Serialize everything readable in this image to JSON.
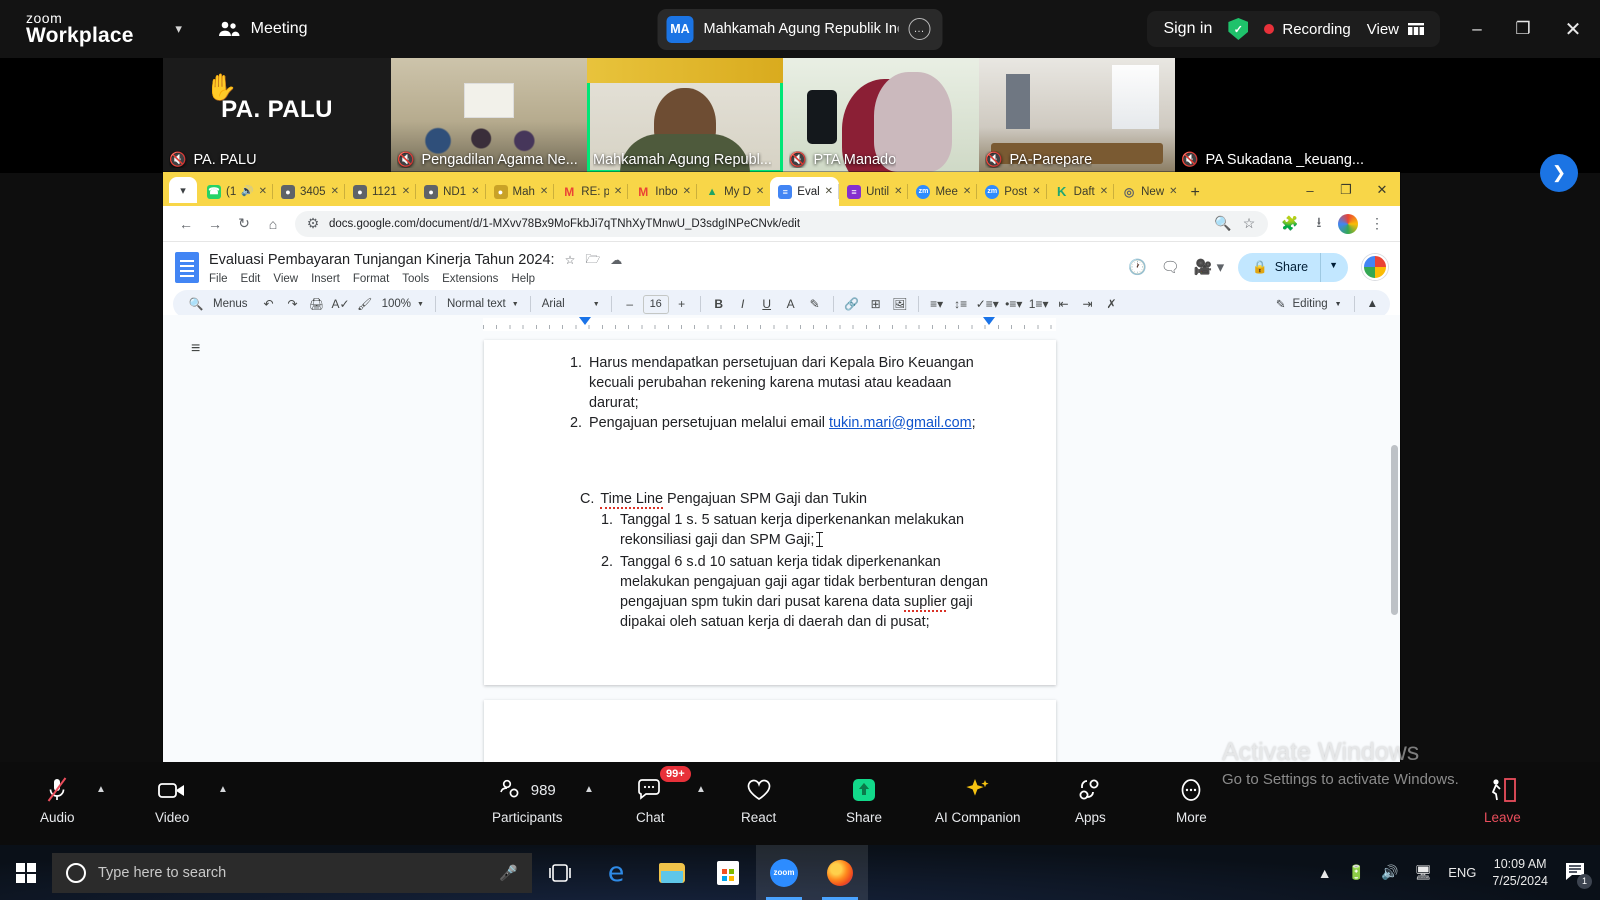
{
  "zoom": {
    "brand_line1": "zoom",
    "brand_line2": "Workplace",
    "meeting_label": "Meeting",
    "meeting_title": "Mahkamah Agung Republik Indo",
    "meeting_avatar_initials": "MA",
    "sign_in": "Sign in",
    "recording": "Recording",
    "view": "View",
    "accent_green": "#1fc26b",
    "record_red": "#e8313a",
    "thumbnails": [
      {
        "name": "PA. PALU",
        "kind": "name-only",
        "muted": true,
        "raised_hand": true,
        "active": false
      },
      {
        "name": "Pengadilan Agama Ne...",
        "kind": "room",
        "muted": true,
        "raised_hand": false,
        "active": false
      },
      {
        "name": "Mahkamah Agung Republ...",
        "kind": "speaker",
        "muted": false,
        "raised_hand": false,
        "active": true
      },
      {
        "name": "PTA Manado",
        "kind": "pta",
        "muted": true,
        "raised_hand": false,
        "active": false
      },
      {
        "name": "PA-Parepare",
        "kind": "office",
        "muted": true,
        "raised_hand": false,
        "active": false
      },
      {
        "name": "PA Sukadana _keuang...",
        "kind": "black",
        "muted": true,
        "raised_hand": false,
        "active": false
      }
    ],
    "controls": [
      {
        "label": "Audio",
        "icon": "microphone-muted-icon",
        "has_chevron": true,
        "badge": null
      },
      {
        "label": "Video",
        "icon": "camera-icon",
        "has_chevron": true,
        "badge": null
      },
      {
        "label": "Participants",
        "icon": "participants-icon",
        "has_chevron": true,
        "badge": null,
        "count": "989"
      },
      {
        "label": "Chat",
        "icon": "chat-icon",
        "has_chevron": true,
        "badge": "99+"
      },
      {
        "label": "React",
        "icon": "heart-icon",
        "has_chevron": false,
        "badge": null
      },
      {
        "label": "Share",
        "icon": "share-screen-icon",
        "has_chevron": false,
        "badge": null
      },
      {
        "label": "AI Companion",
        "icon": "sparkle-icon",
        "has_chevron": false,
        "badge": null
      },
      {
        "label": "Apps",
        "icon": "apps-icon",
        "has_chevron": false,
        "badge": null
      },
      {
        "label": "More",
        "icon": "more-dots-icon",
        "has_chevron": false,
        "badge": null
      },
      {
        "label": "Leave",
        "icon": "leave-door-icon",
        "has_chevron": false,
        "badge": null
      }
    ]
  },
  "browser": {
    "tabs": [
      {
        "title": "(1",
        "favicon": "whatsapp",
        "favicon_char": "✆",
        "favicon_color": "#25d366",
        "active": false,
        "audio": true
      },
      {
        "title": "3405",
        "favicon": "globe",
        "favicon_char": "●",
        "favicon_color": "#5f6368",
        "active": false
      },
      {
        "title": "1121",
        "favicon": "globe",
        "favicon_char": "●",
        "favicon_color": "#5f6368",
        "active": false
      },
      {
        "title": "ND1",
        "favicon": "globe",
        "favicon_char": "●",
        "favicon_color": "#5f6368",
        "active": false
      },
      {
        "title": "Mah",
        "favicon": "seal",
        "favicon_char": "●",
        "favicon_color": "#c9a227",
        "active": false
      },
      {
        "title": "RE: p",
        "favicon": "gmail",
        "favicon_char": "M",
        "favicon_color": "#ea4335",
        "active": false
      },
      {
        "title": "Inbo",
        "favicon": "gmail",
        "favicon_char": "M",
        "favicon_color": "#ea4335",
        "active": false
      },
      {
        "title": "My D",
        "favicon": "drive",
        "favicon_char": "▲",
        "favicon_color": "#1fa463",
        "active": false
      },
      {
        "title": "Eval",
        "favicon": "docs",
        "favicon_char": "≡",
        "favicon_color": "#4285f4",
        "active": true
      },
      {
        "title": "Until",
        "favicon": "slides",
        "favicon_char": "≡",
        "favicon_color": "#8430ce",
        "active": false
      },
      {
        "title": "Mee",
        "favicon": "zoom",
        "favicon_char": "zm",
        "favicon_color": "#2d8cff",
        "active": false
      },
      {
        "title": "Post",
        "favicon": "zoom",
        "favicon_char": "zm",
        "favicon_color": "#2d8cff",
        "active": false
      },
      {
        "title": "Daft",
        "favicon": "kompas",
        "favicon_char": "K",
        "favicon_color": "#1ea672",
        "active": false
      },
      {
        "title": "New",
        "favicon": "chrome",
        "favicon_char": "◎",
        "favicon_color": "#5f6368",
        "active": false
      }
    ],
    "url": "docs.google.com/document/d/1-MXvv78Bx9MoFkbJi7qTNhXyTMnwU_D3sdgINPeCNvk/edit",
    "new_tab_label": "+"
  },
  "docs": {
    "title": "Evaluasi Pembayaran Tunjangan Kinerja Tahun 2024:",
    "menus": [
      "File",
      "Edit",
      "View",
      "Insert",
      "Format",
      "Tools",
      "Extensions",
      "Help"
    ],
    "share_label": "Share",
    "toolbar": {
      "menus_label": "Menus",
      "zoom_level": "100%",
      "paragraph_style": "Normal text",
      "font_family": "Arial",
      "font_size": "16",
      "mode_label": "Editing"
    },
    "content": {
      "list_a": [
        {
          "num": "1.",
          "text": "Harus mendapatkan persetujuan dari Kepala Biro Keuangan kecuali perubahan rekening karena mutasi atau keadaan darurat;"
        },
        {
          "num": "2.",
          "text": "Pengajuan persetujuan melalui email ",
          "link": "tukin.mari@gmail.com",
          "suffix": ";"
        }
      ],
      "section_c": {
        "marker": "C.",
        "underlined": "Time Line",
        "rest": " Pengajuan SPM Gaji dan Tukin"
      },
      "list_c": [
        {
          "num": "1.",
          "text": "Tanggal 1 s. 5 satuan kerja diperkenankan melakukan rekonsiliasi gaji dan SPM Gaji;"
        },
        {
          "num": "2.",
          "pre": "Tanggal 6 s.d 10 satuan kerja tidak diperkenankan melakukan pengajuan gaji agar tidak berbenturan dengan pengajuan spm tukin dari pusat karena data ",
          "misspelled": "suplier",
          "post": " gaji dipakai oleh satuan kerja di daerah dan di pusat;"
        }
      ]
    }
  },
  "watermark": {
    "line1": "Activate Windows",
    "line2": "Go to Settings to activate Windows."
  },
  "taskbar": {
    "search_placeholder": "Type here to search",
    "language": "ENG",
    "time": "10:09 AM",
    "date": "7/25/2024",
    "notification_count": "1",
    "apps": [
      {
        "name": "task-view",
        "active": false
      },
      {
        "name": "edge",
        "active": false
      },
      {
        "name": "file-explorer",
        "active": false
      },
      {
        "name": "microsoft-store",
        "active": false
      },
      {
        "name": "zoom",
        "active": true
      },
      {
        "name": "firefox",
        "active": true
      }
    ]
  }
}
